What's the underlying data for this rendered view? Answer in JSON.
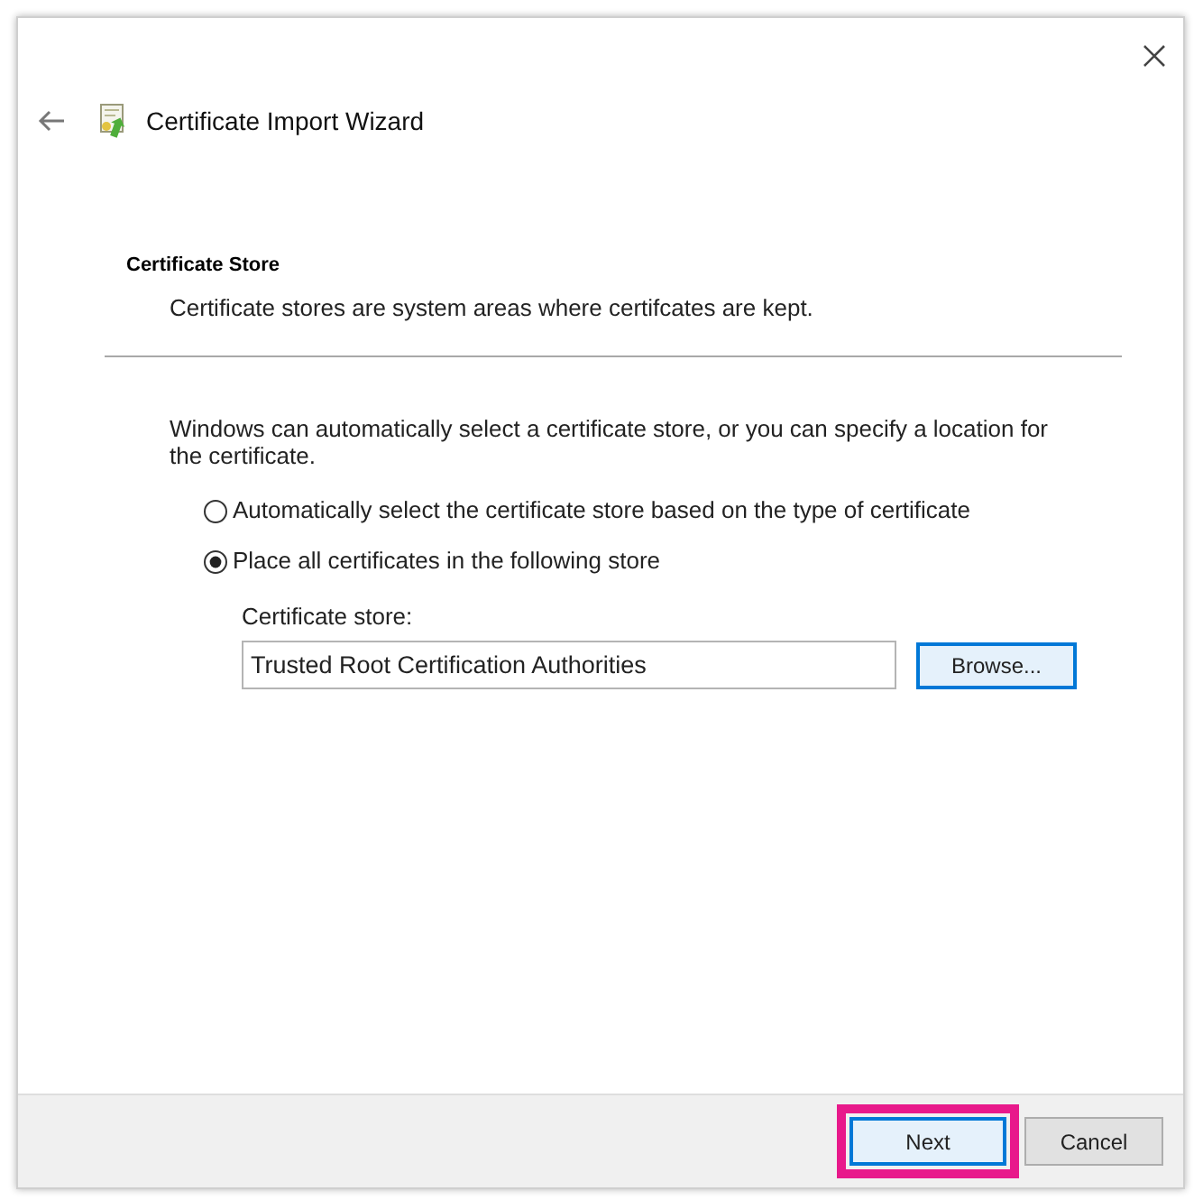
{
  "window": {
    "title": "Certificate Import Wizard"
  },
  "header": {
    "heading": "Certificate Store",
    "description": "Certificate stores are system areas where certifcates are kept."
  },
  "intro": "Windows can automatically select a certificate store, or you can specify a location for the certificate.",
  "options": [
    {
      "label": "Automatically select the certificate store based on the type of certificate",
      "selected": false
    },
    {
      "label": "Place all certificates in the following store",
      "selected": true
    }
  ],
  "store_field": {
    "label": "Certificate store:",
    "value": "Trusted Root Certification Authorities"
  },
  "browse_button": {
    "label": "Browse...",
    "focused": true
  },
  "footer_buttons": [
    {
      "label": "Next",
      "focused": true,
      "highlighted": true
    },
    {
      "label": "Cancel",
      "focused": false,
      "highlighted": false
    }
  ]
}
